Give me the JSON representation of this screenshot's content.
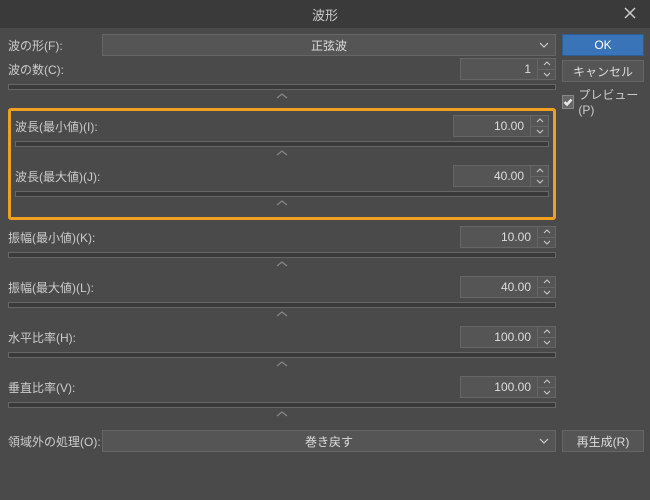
{
  "window": {
    "title": "波形"
  },
  "labels": {
    "waveform": "波の形(F):",
    "wavecount": "波の数(C):",
    "wavelength_min": "波長(最小値)(I):",
    "wavelength_max": "波長(最大値)(J):",
    "amplitude_min": "振幅(最小値)(K):",
    "amplitude_max": "振幅(最大値)(L):",
    "hratio": "水平比率(H):",
    "vratio": "垂直比率(V):",
    "outside": "領域外の処理(O):"
  },
  "values": {
    "waveform_type": "正弦波",
    "wavecount": "1",
    "wavelength_min": "10.00",
    "wavelength_max": "40.00",
    "amplitude_min": "10.00",
    "amplitude_max": "40.00",
    "hratio": "100.00",
    "vratio": "100.00",
    "outside_mode": "巻き戻す"
  },
  "buttons": {
    "ok": "OK",
    "cancel": "キャンセル",
    "preview": "プレビュー(P)",
    "regenerate": "再生成(R)"
  }
}
